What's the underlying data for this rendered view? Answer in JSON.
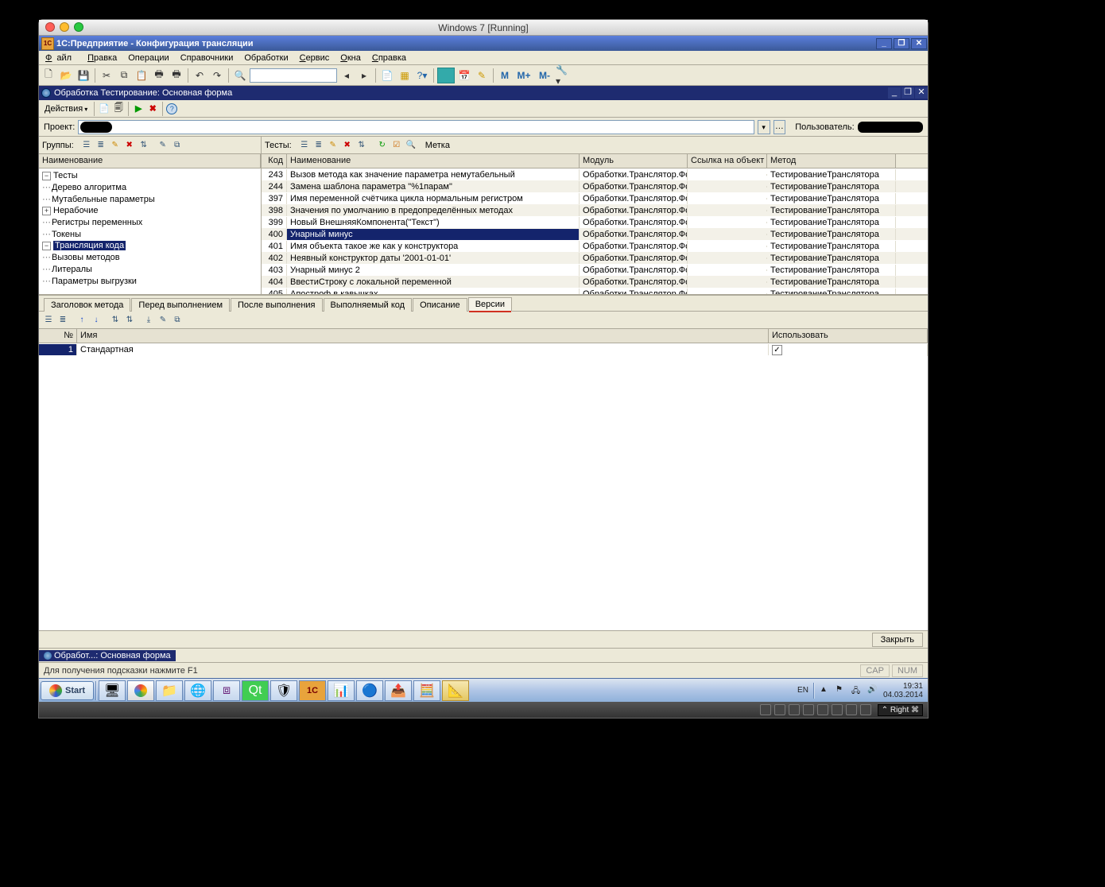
{
  "mac_title": "Windows 7 [Running]",
  "app_title": "1С:Предприятие - Конфигурация трансляции",
  "menu": [
    "Файл",
    "Правка",
    "Операции",
    "Справочники",
    "Обработки",
    "Сервис",
    "Окна",
    "Справка"
  ],
  "menu_ul": [
    "Ф",
    "П",
    "",
    "",
    "",
    "С",
    "О",
    "С"
  ],
  "m_labels": {
    "m": "M",
    "mp": "M+",
    "mm": "M-"
  },
  "sub_title": "Обработка Тестирование: Основная форма",
  "actions_label": "Действия",
  "filter": {
    "project_label": "Проект:",
    "user_label": "Пользователь:"
  },
  "left_tb_label": "Группы:",
  "right_tb_label": "Тесты:",
  "right_tb_mark": "Метка",
  "tree_header": "Наименование",
  "tree": {
    "root": "Тесты",
    "items": [
      "Дерево алгоритма",
      "Мутабельные параметры",
      "Нерабочие",
      "Регистры переменных",
      "Токены",
      "Трансляция кода",
      "Вызовы методов",
      "Литералы",
      "Параметры выгрузки"
    ]
  },
  "grid_headers": {
    "code": "Код",
    "name": "Наименование",
    "module": "Модуль",
    "link": "Ссылка на объект",
    "method": "Метод"
  },
  "rows": [
    {
      "code": "243",
      "name": "Вызов метода как значение параметра немутабельный",
      "mod": "Обработки.Транслятор.Фор...",
      "meth": "ТестированиеТранслятора"
    },
    {
      "code": "244",
      "name": "Замена шаблона параметра \"%1парам\"",
      "mod": "Обработки.Транслятор.Фор...",
      "meth": "ТестированиеТранслятора"
    },
    {
      "code": "397",
      "name": "Имя переменной счётчика цикла нормальным регистром",
      "mod": "Обработки.Транслятор.Фор...",
      "meth": "ТестированиеТранслятора"
    },
    {
      "code": "398",
      "name": "Значения по умолчанию в предопределённых методах",
      "mod": "Обработки.Транслятор.Фор...",
      "meth": "ТестированиеТранслятора"
    },
    {
      "code": "399",
      "name": "Новый ВнешняяКомпонента(\"Текст\")",
      "mod": "Обработки.Транслятор.Фор...",
      "meth": "ТестированиеТранслятора"
    },
    {
      "code": "400",
      "name": "Унарный минус",
      "mod": "Обработки.Транслятор.Фор...",
      "meth": "ТестированиеТранслятора"
    },
    {
      "code": "401",
      "name": "Имя объекта такое же как у конструктора",
      "mod": "Обработки.Транслятор.Фор...",
      "meth": "ТестированиеТранслятора"
    },
    {
      "code": "402",
      "name": "Неявный конструктор даты '2001-01-01'",
      "mod": "Обработки.Транслятор.Фор...",
      "meth": "ТестированиеТранслятора"
    },
    {
      "code": "403",
      "name": "Унарный минус 2",
      "mod": "Обработки.Транслятор.Фор...",
      "meth": "ТестированиеТранслятора"
    },
    {
      "code": "404",
      "name": "ВвестиСтроку с локальной переменной",
      "mod": "Обработки.Транслятор.Фор...",
      "meth": "ТестированиеТранслятора"
    },
    {
      "code": "405",
      "name": "Апостроф в кавычках",
      "mod": "Обработки.Транслятор.Фор...",
      "meth": "ТестированиеТранслятора"
    }
  ],
  "selected_code": "400",
  "tabs": [
    "Заголовок метода",
    "Перед выполнением",
    "После выполнения",
    "Выполняемый код",
    "Описание",
    "Версии"
  ],
  "active_tab": "Версии",
  "lower_headers": {
    "num": "№",
    "name": "Имя",
    "use": "Использовать"
  },
  "lower_row": {
    "num": "1",
    "name": "Стандартная",
    "use": true
  },
  "close_label": "Закрыть",
  "wndtab_label": "Обработ...: Основная форма",
  "status_hint": "Для получения подсказки нажмите F1",
  "status_cap": "CAP",
  "status_num": "NUM",
  "taskbar": {
    "start": "Start",
    "lang": "EN",
    "time": "19:31",
    "date": "04.03.2014"
  },
  "vm_right": "Right ⌘"
}
